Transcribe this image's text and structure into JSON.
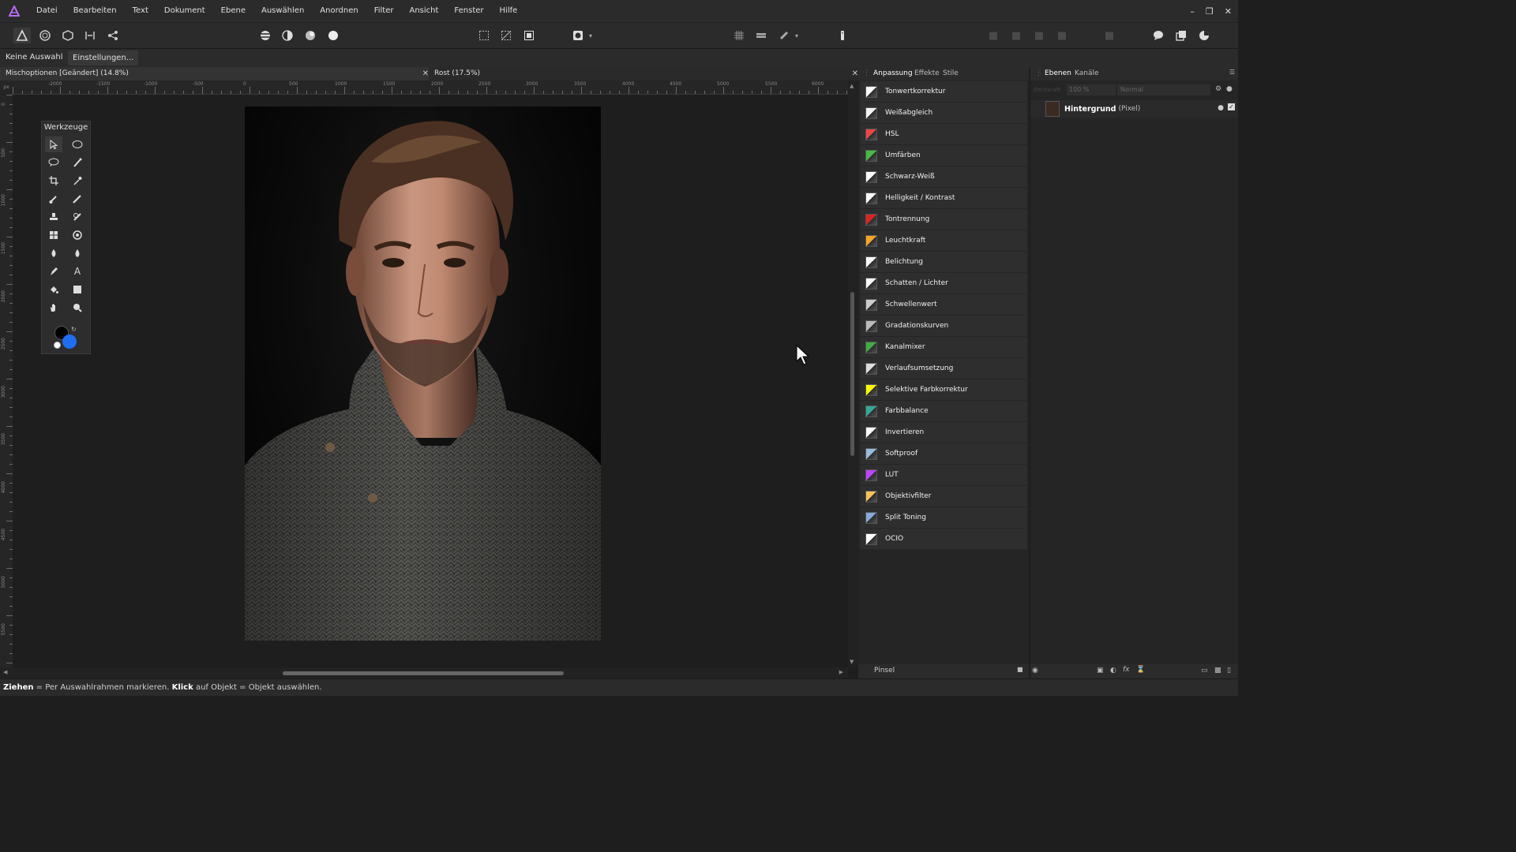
{
  "menu": {
    "items": [
      "Datei",
      "Bearbeiten",
      "Text",
      "Dokument",
      "Ebene",
      "Auswählen",
      "Anordnen",
      "Filter",
      "Ansicht",
      "Fenster",
      "Hilfe"
    ]
  },
  "context_bar": {
    "selection": "Keine Auswahl",
    "settings_button": "Einstellungen..."
  },
  "documents": {
    "tab1": "Mischoptionen [Geändert] (14.8%)",
    "tab2": "Rost (17.5%)"
  },
  "ruler": {
    "unit": "px",
    "horizontal": [
      "-2000",
      "-1500",
      "-1000",
      "-500",
      "0",
      "500",
      "1000",
      "1500",
      "2000",
      "2500",
      "3000",
      "3500",
      "4000",
      "4500",
      "5000",
      "5500",
      "6000"
    ],
    "vertical": [
      "0",
      "500",
      "1000",
      "1500",
      "2000",
      "2500",
      "3000",
      "3500",
      "4000",
      "4500",
      "5000",
      "5500"
    ]
  },
  "tools_panel": {
    "title": "Werkzeuge",
    "text_tool_glyph": "A"
  },
  "adjustments_panel": {
    "tabs": [
      "Anpassung",
      "Effekte",
      "Stile"
    ],
    "items": [
      {
        "label": "Tonwertkorrektur",
        "icon": "levels-icon"
      },
      {
        "label": "Weißabgleich",
        "icon": "white-balance-icon"
      },
      {
        "label": "HSL",
        "icon": "hsl-icon"
      },
      {
        "label": "Umfärben",
        "icon": "recolor-icon"
      },
      {
        "label": "Schwarz-Weiß",
        "icon": "black-white-icon"
      },
      {
        "label": "Helligkeit / Kontrast",
        "icon": "brightness-contrast-icon"
      },
      {
        "label": "Tontrennung",
        "icon": "posterize-icon"
      },
      {
        "label": "Leuchtkraft",
        "icon": "vibrance-icon"
      },
      {
        "label": "Belichtung",
        "icon": "exposure-icon"
      },
      {
        "label": "Schatten / Lichter",
        "icon": "shadows-highlights-icon"
      },
      {
        "label": "Schwellenwert",
        "icon": "threshold-icon"
      },
      {
        "label": "Gradationskurven",
        "icon": "curves-icon"
      },
      {
        "label": "Kanalmixer",
        "icon": "channel-mixer-icon"
      },
      {
        "label": "Verlaufsumsetzung",
        "icon": "gradient-map-icon"
      },
      {
        "label": "Selektive Farbkorrektur",
        "icon": "selective-color-icon"
      },
      {
        "label": "Farbbalance",
        "icon": "color-balance-icon"
      },
      {
        "label": "Invertieren",
        "icon": "invert-icon"
      },
      {
        "label": "Softproof",
        "icon": "soft-proof-icon"
      },
      {
        "label": "LUT",
        "icon": "lut-icon"
      },
      {
        "label": "Objektivfilter",
        "icon": "lens-filter-icon"
      },
      {
        "label": "Split Toning",
        "icon": "split-toning-icon"
      },
      {
        "label": "OCIO",
        "icon": "ocio-icon"
      }
    ],
    "brush_label": "Pinsel"
  },
  "layers_panel": {
    "tabs": [
      "Ebenen",
      "Kanäle"
    ],
    "opacity_label": "Deckkraft:",
    "opacity": "100 %",
    "blend_mode": "Normal",
    "layer": {
      "name": "Hintergrund",
      "type": "(Pixel)"
    }
  },
  "status_bar": {
    "bold1": "Ziehen",
    "text1": " = Per Auswahlrahmen markieren. ",
    "bold2": "Klick",
    "text2": " auf Objekt = Objekt auswählen."
  },
  "colors": {
    "accent_blue": "#1e6ef0",
    "app_bg": "#1e1e1e",
    "panel_bg": "#2b2b2b",
    "logo_purple": "#9b4fe0"
  }
}
